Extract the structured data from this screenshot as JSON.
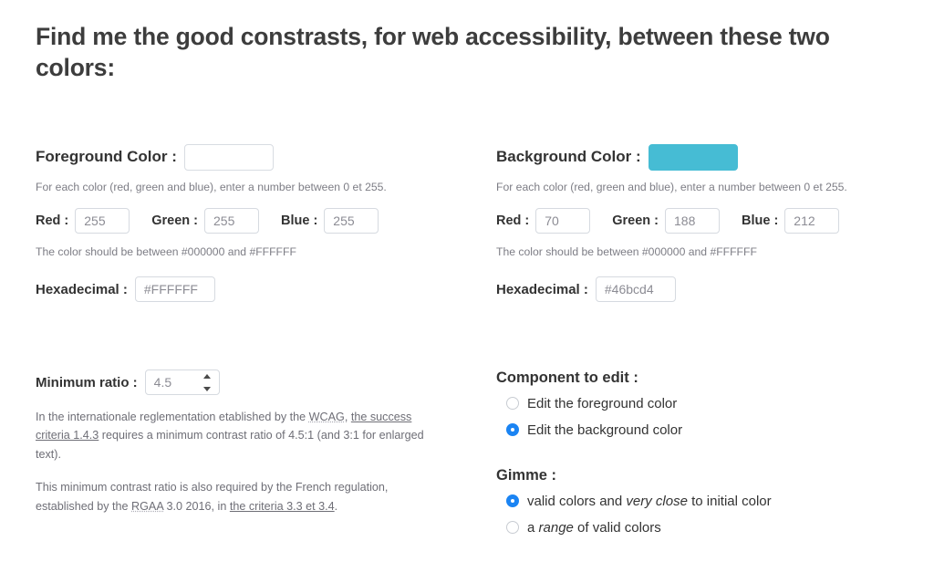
{
  "page": {
    "title": "Find me the good constrasts, for web accessibility, between these two colors:"
  },
  "colors": {
    "foreground_swatch_hex": "#FFFFFF",
    "background_swatch_hex": "#46bcd4",
    "accent_radio_hex": "#1b84f3"
  },
  "foreground": {
    "heading_label": "Foreground Color :",
    "help_rgb": "For each color (red, green and blue), enter a number between 0 et 255.",
    "red_label": "Red :",
    "red_value": "255",
    "green_label": "Green :",
    "green_value": "255",
    "blue_label": "Blue :",
    "blue_value": "255",
    "help_hex": "The color should be between #000000 and #FFFFFF",
    "hex_label": "Hexadecimal :",
    "hex_value": "#FFFFFF"
  },
  "background": {
    "heading_label": "Background Color :",
    "help_rgb": "For each color (red, green and blue), enter a number between 0 et 255.",
    "red_label": "Red :",
    "red_value": "70",
    "green_label": "Green :",
    "green_value": "188",
    "blue_label": "Blue :",
    "blue_value": "212",
    "help_hex": "The color should be between #000000 and #FFFFFF",
    "hex_label": "Hexadecimal :",
    "hex_value": "#46bcd4"
  },
  "ratio": {
    "label": "Minimum ratio :",
    "value": "4.5",
    "paragraph1": {
      "part1": "In the internationale reglementation etablished by the ",
      "abbr": "WCAG",
      "part2": ", ",
      "link": "the success criteria 1.4.3",
      "part3": " requires a minimum contrast ratio of 4.5:1 (and 3:1 for enlarged text)."
    },
    "paragraph2": {
      "part1": "This minimum contrast ratio is also required by the French regulation, established by the ",
      "abbr": "RGAA",
      "part2": " 3.0 2016, in ",
      "link": "the criteria 3.3 et 3.4",
      "part3": "."
    }
  },
  "component_to_edit": {
    "title": "Component to edit :",
    "options": [
      {
        "label": "Edit the foreground color",
        "checked": false
      },
      {
        "label": "Edit the background color",
        "checked": true
      }
    ]
  },
  "gimme": {
    "title": "Gimme :",
    "options": [
      {
        "pre": "valid colors and ",
        "em": "very close",
        "post": " to initial color",
        "checked": true
      },
      {
        "pre": "a ",
        "em": "range",
        "post": " of valid colors",
        "checked": false
      }
    ]
  }
}
